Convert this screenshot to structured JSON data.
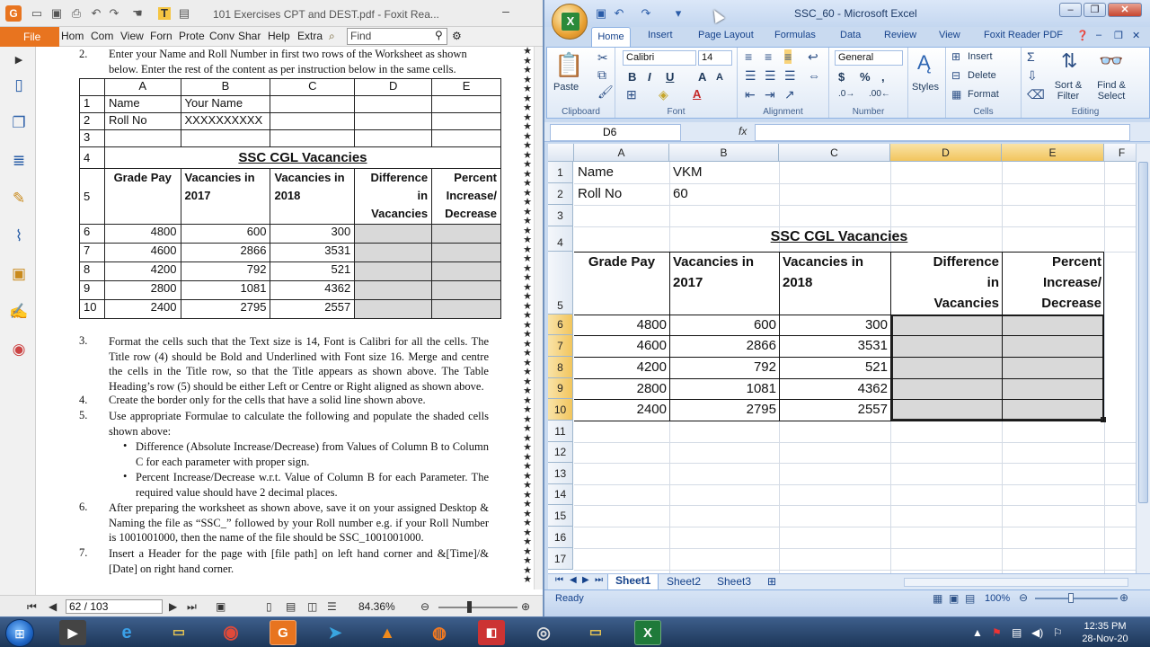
{
  "foxit": {
    "title": "101 Exercises CPT and DEST.pdf - Foxit Rea...",
    "menu": [
      "Hom",
      "Com",
      "View",
      "Forn",
      "Prote",
      "Conv",
      "Shar",
      "Help",
      "Extra"
    ],
    "file_label": "File",
    "find_placeholder": "Find",
    "page_display": "62 / 103",
    "zoom": "84.36%",
    "doc": {
      "item2_num": "2.",
      "item2_line1": "Enter your Name and Roll Number in first two rows of the Worksheet as shown",
      "item2_line2": "below. Enter the rest of the content as per instruction below in the same cells.",
      "table": {
        "col_headers": [
          "A",
          "B",
          "C",
          "D",
          "E"
        ],
        "r1": [
          "1",
          "Name",
          "Your Name"
        ],
        "r2": [
          "2",
          "Roll No",
          "XXXXXXXXXX"
        ],
        "r3": "3",
        "r4": [
          "4",
          "SSC CGL Vacancies"
        ],
        "r5": [
          "5",
          "Grade Pay",
          "Vacancies in 2017",
          "Vacancies in 2018",
          "Difference in Vacancies",
          "Percent Increase/ Decrease"
        ],
        "rows": [
          [
            "6",
            "4800",
            "600",
            "300"
          ],
          [
            "7",
            "4600",
            "2866",
            "3531"
          ],
          [
            "8",
            "4200",
            "792",
            "521"
          ],
          [
            "9",
            "2800",
            "1081",
            "4362"
          ],
          [
            "10",
            "2400",
            "2795",
            "2557"
          ]
        ]
      },
      "item3_num": "3.",
      "item3_text": "Format the cells such that the Text size is 14, Font is Calibri for all the cells. The Title row (4) should be Bold and Underlined with Font size 16. Merge and centre the cells in the Title row, so that the Title appears as shown above. The Table Heading’s row (5) should be either Left or Centre or Right aligned as shown above.",
      "item4_num": "4.",
      "item4_text": "Create the border only for the cells that have a solid line shown above.",
      "item5_num": "5.",
      "item5_text": "Use appropriate Formulae to calculate the following and populate the shaded cells shown above:",
      "bullet1": "Difference (Absolute Increase/Decrease) from Values of Column B to Column C for each parameter with proper sign.",
      "bullet2": "Percent Increase/Decrease w.r.t. Value of Column B for each Parameter. The required value should have 2 decimal places.",
      "item6_num": "6.",
      "item6_text": "After preparing the worksheet as shown above, save it on your assigned Desktop & Naming the file as “SSC_” followed by your Roll number e.g. if your Roll Number is 1001001000, then the name of the file should be SSC_1001001000.",
      "item7_num": "7.",
      "item7_text": "Insert a Header for the page with [file path] on left hand corner and &[Time]/&[Date] on right hand corner."
    }
  },
  "excel": {
    "title": "SSC_60 - Microsoft Excel",
    "tabs": [
      "Home",
      "Insert",
      "Page Layout",
      "Formulas",
      "Data",
      "Review",
      "View",
      "Foxit Reader PDF"
    ],
    "ribbon": {
      "paste": "Paste",
      "clipboard": "Clipboard",
      "font_name": "Calibri",
      "font_size": "14",
      "font_group": "Font",
      "alignment": "Alignment",
      "number_format": "General",
      "number": "Number",
      "styles": "Styles",
      "insert": "Insert",
      "delete": "Delete",
      "format": "Format",
      "cells": "Cells",
      "sort_filter": "Sort & Filter",
      "find_select": "Find & Select",
      "editing": "Editing"
    },
    "name_box": "D6",
    "fx": "fx",
    "columns": [
      "A",
      "B",
      "C",
      "D",
      "E",
      "F"
    ],
    "rows": [
      "1",
      "2",
      "3",
      "4",
      "5",
      "6",
      "7",
      "8",
      "9",
      "10",
      "11",
      "12",
      "13",
      "14",
      "15",
      "16",
      "17"
    ],
    "cells": {
      "a1": "Name",
      "b1": "VKM",
      "a2": "Roll No",
      "b2": "60",
      "title": "SSC CGL Vacancies",
      "a5": "Grade Pay",
      "b5_1": "Vacancies in",
      "b5_2": "2017",
      "c5_1": "Vacancies in",
      "c5_2": "2018",
      "d5_1": "Difference",
      "d5_2": "in",
      "d5_3": "Vacancies",
      "e5_1": "Percent",
      "e5_2": "Increase/",
      "e5_3": "Decrease",
      "data": [
        [
          "4800",
          "600",
          "300"
        ],
        [
          "4600",
          "2866",
          "3531"
        ],
        [
          "4200",
          "792",
          "521"
        ],
        [
          "2800",
          "1081",
          "4362"
        ],
        [
          "2400",
          "2795",
          "2557"
        ]
      ]
    },
    "sheets": [
      "Sheet1",
      "Sheet2",
      "Sheet3"
    ],
    "status": "Ready",
    "zoom": "100%"
  },
  "taskbar": {
    "time": "12:35 PM",
    "date": "28-Nov-20"
  }
}
